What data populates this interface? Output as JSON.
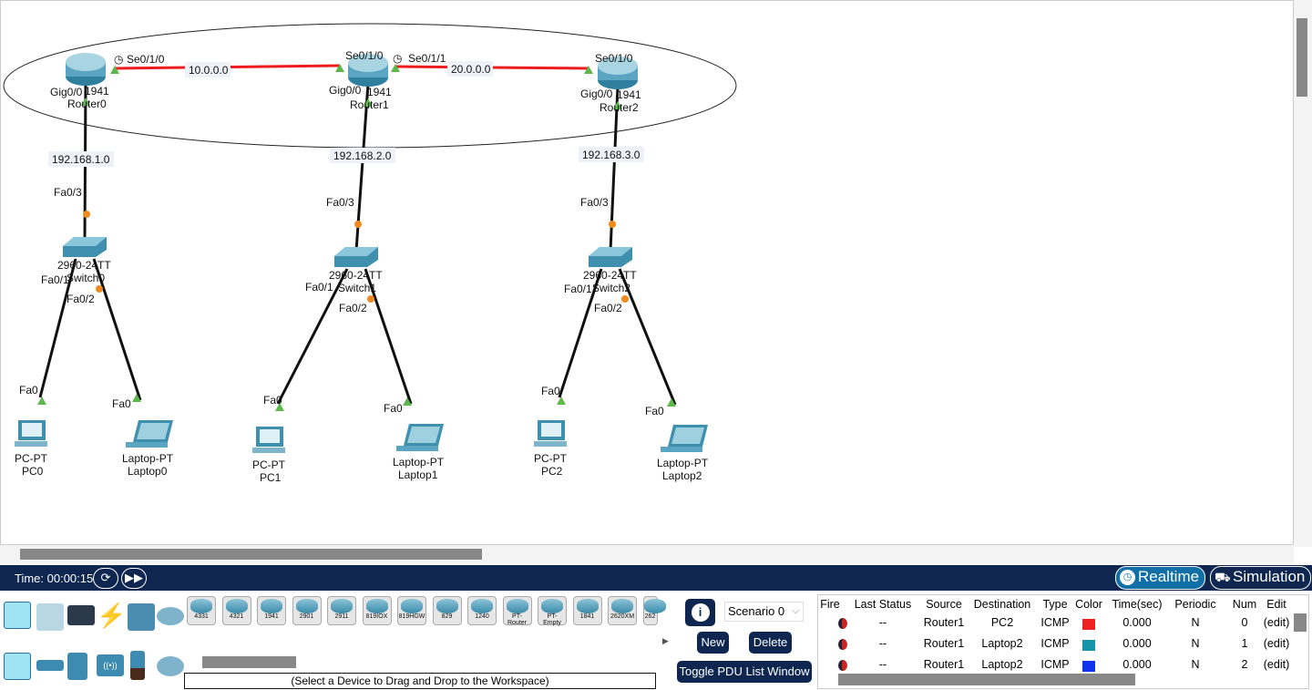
{
  "workspace": {
    "routers": [
      {
        "model": "1941",
        "name": "Router0"
      },
      {
        "model": "1941",
        "name": "Router1"
      },
      {
        "model": "1941",
        "name": "Router2"
      }
    ],
    "switches": [
      {
        "model": "2960-24TT",
        "name": "Switch0"
      },
      {
        "model": "2960-24TT",
        "name": "Switch1"
      },
      {
        "model": "2960-24TT",
        "name": "Switch2"
      }
    ],
    "pcs": [
      {
        "model": "PC-PT",
        "name": "PC0"
      },
      {
        "model": "PC-PT",
        "name": "PC1"
      },
      {
        "model": "PC-PT",
        "name": "PC2"
      }
    ],
    "laptops": [
      {
        "model": "Laptop-PT",
        "name": "Laptop0"
      },
      {
        "model": "Laptop-PT",
        "name": "Laptop1"
      },
      {
        "model": "Laptop-PT",
        "name": "Laptop2"
      }
    ],
    "serial_links": [
      {
        "network": "10.0.0.0",
        "a_port": "Se0/1/0",
        "b_port": "Se0/1/0"
      },
      {
        "network": "20.0.0.0",
        "a_port": "Se0/1/1",
        "b_port": "Se0/1/0"
      }
    ],
    "lans": [
      {
        "network": "192.168.1.0",
        "router_port": "Gig0/0",
        "switch_uplink": "Fa0/3",
        "switch_p1": "Fa0/1",
        "switch_p2": "Fa0/2",
        "pc_port": "Fa0",
        "laptop_port": "Fa0"
      },
      {
        "network": "192.168.2.0",
        "router_port": "Gig0/0",
        "switch_uplink": "Fa0/3",
        "switch_p1": "Fa0/1",
        "switch_p2": "Fa0/2",
        "pc_port": "Fa0",
        "laptop_port": "Fa0"
      },
      {
        "network": "192.168.3.0",
        "router_port": "Gig0/0",
        "switch_uplink": "Fa0/3",
        "switch_p1": "Fa0/1",
        "switch_p2": "Fa0/2",
        "pc_port": "Fa0",
        "laptop_port": "Fa0"
      }
    ],
    "colors": {
      "serial": "#ee1c1c",
      "ethernet": "#111111",
      "link_up": "#5cb84a",
      "link_amber": "#f08a1c"
    }
  },
  "statusbar": {
    "time_label": "Time: 00:00:15",
    "realtime": "Realtime",
    "simulation": "Simulation"
  },
  "device_palette": {
    "devices": [
      "4331",
      "4321",
      "1941",
      "2901",
      "2911",
      "819IOX",
      "819HGW",
      "829",
      "1240",
      "PT-Router",
      "PT-Empty",
      "1841",
      "2620XM",
      "262"
    ],
    "hint": "(Select a Device to Drag and Drop to the Workspace)"
  },
  "scenario": {
    "selected": "Scenario 0",
    "new": "New",
    "delete": "Delete",
    "toggle": "Toggle PDU List Window"
  },
  "pdu_list": {
    "headers": [
      "Fire",
      "Last Status",
      "Source",
      "Destination",
      "Type",
      "Color",
      "Time(sec)",
      "Periodic",
      "Num",
      "Edit"
    ],
    "rows": [
      {
        "last_status": "--",
        "source": "Router1",
        "destination": "PC2",
        "type": "ICMP",
        "color": "#ee2222",
        "time": "0.000",
        "periodic": "N",
        "num": "0",
        "edit": "(edit)"
      },
      {
        "last_status": "--",
        "source": "Router1",
        "destination": "Laptop2",
        "type": "ICMP",
        "color": "#1496a8",
        "time": "0.000",
        "periodic": "N",
        "num": "1",
        "edit": "(edit)"
      },
      {
        "last_status": "--",
        "source": "Router1",
        "destination": "Laptop2",
        "type": "ICMP",
        "color": "#1133ee",
        "time": "0.000",
        "periodic": "N",
        "num": "2",
        "edit": "(edit)"
      }
    ]
  }
}
